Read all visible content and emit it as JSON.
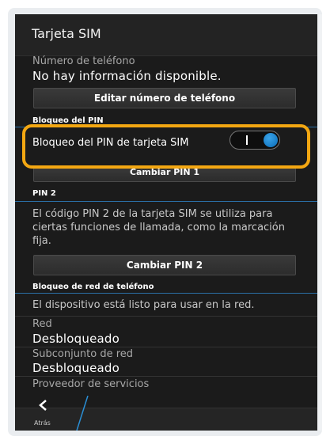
{
  "window": {
    "title": "Tarjeta SIM"
  },
  "phone": {
    "label": "Número de teléfono",
    "value": "No hay información disponible.",
    "edit_button": "Editar número de teléfono"
  },
  "pin_lock": {
    "section_header": "Bloqueo del PIN",
    "toggle_label": "Bloqueo del PIN de tarjeta SIM",
    "toggle_on_glyph": "I",
    "toggle_state": "on",
    "change_pin1_button": "Cambiar PIN 1"
  },
  "pin2": {
    "section_header": "PIN 2",
    "description": "El código PIN 2 de la tarjeta SIM se utiliza para ciertas funciones de llamada, como la marcación fija.",
    "change_pin2_button": "Cambiar PIN 2"
  },
  "network_lock": {
    "section_header": "Bloqueo de red de teléfono",
    "status_text": "El dispositivo está listo para usar en la red.",
    "red_label": "Red",
    "red_value": "Desbloqueado",
    "subset_label": "Subconjunto de red",
    "subset_value": "Desbloqueado",
    "provider_label": "Proveedor de servicios"
  },
  "bottom_bar": {
    "back_label": "Atrás"
  },
  "colors": {
    "accent": "#2a6fa6",
    "highlight": "#f3a712",
    "toggle_knob": "#0a6cb8",
    "background": "#1b1b1b"
  }
}
